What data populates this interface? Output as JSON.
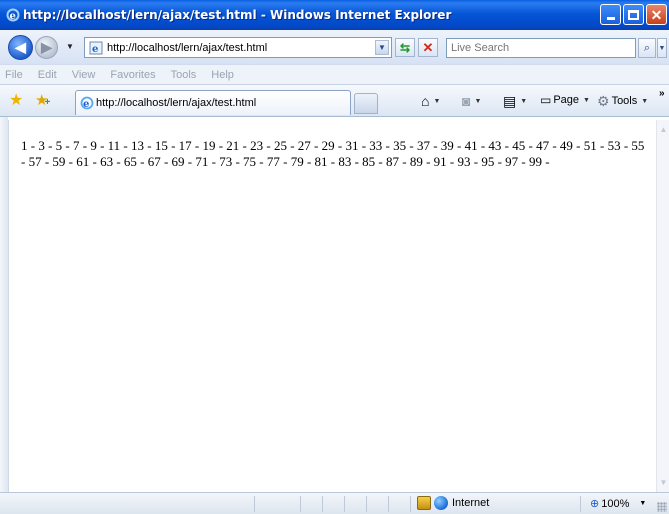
{
  "window": {
    "title": "http://localhost/lern/ajax/test.html - Windows Internet Explorer"
  },
  "address_bar": {
    "url": "http://localhost/lern/ajax/test.html"
  },
  "search": {
    "placeholder": "Live Search"
  },
  "menu": {
    "items": [
      "File",
      "Edit",
      "View",
      "Favorites",
      "Tools",
      "Help"
    ]
  },
  "tabs": [
    {
      "label": "http://localhost/lern/ajax/test.html",
      "active": true
    }
  ],
  "command_bar": {
    "page_label": "Page",
    "tools_label": "Tools"
  },
  "content": {
    "text": "1 - 3 - 5 - 7 - 9 - 11 - 13 - 15 - 17 - 19 - 21 - 23 - 25 - 27 - 29 - 31 - 33 - 35 - 37 - 39 - 41 - 43 - 45 - 47 - 49 - 51 - 53 - 55 - 57 - 59 - 61 - 63 - 65 - 67 - 69 - 71 - 73 - 75 - 77 - 79 - 81 - 83 - 85 - 87 - 89 - 91 - 93 - 95 - 97 - 99 -"
  },
  "status_bar": {
    "zone": "Internet",
    "zoom": "100%"
  },
  "colors": {
    "titlebar": "#0656d8",
    "menu_text_disabled": "#9aa3b1"
  }
}
